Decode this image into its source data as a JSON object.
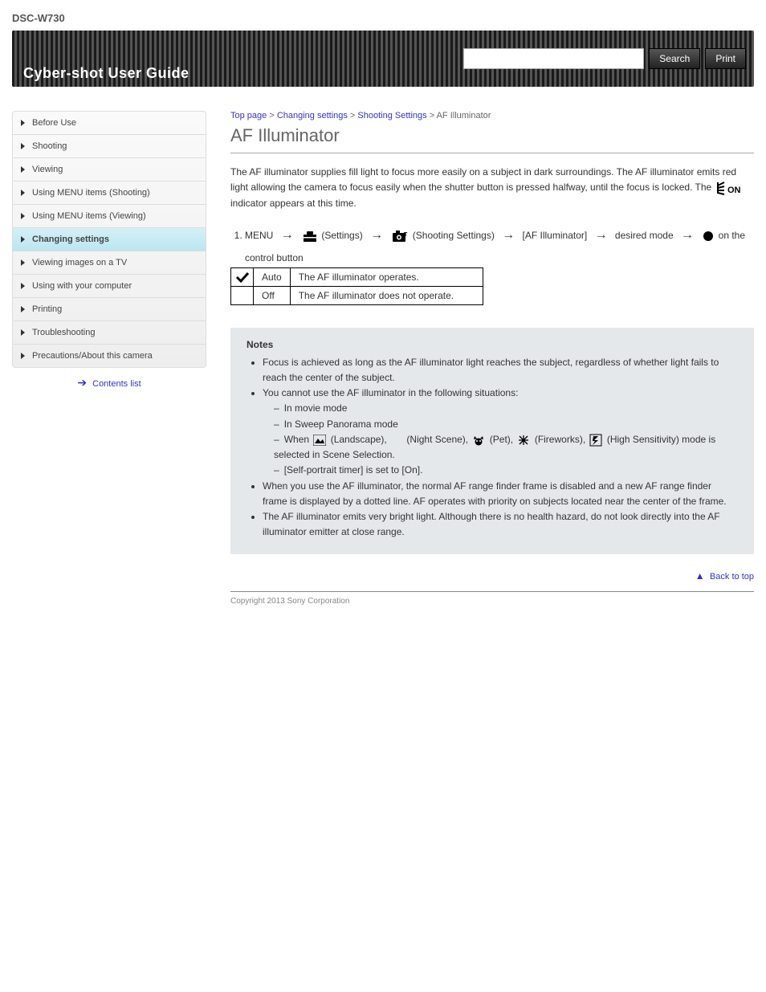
{
  "header": {
    "product": "DSC-W730",
    "title": "Cyber-shot User Guide",
    "search_placeholder": "",
    "search_btn": "Search",
    "print_btn": "Print"
  },
  "sidebar": {
    "items": [
      "Before Use",
      "Shooting",
      "Viewing",
      "Using MENU items (Shooting)",
      "Using MENU items (Viewing)",
      "Changing settings",
      "Viewing images on a TV",
      "Using with your computer",
      "Printing",
      "Troubleshooting",
      "Precautions/About this camera"
    ],
    "active_index": 5,
    "bottom_link": "Contents list"
  },
  "breadcrumb": {
    "top": "Top page",
    "cat": "Changing settings",
    "group": "Shooting Settings",
    "page": "AF Illuminator"
  },
  "article": {
    "title": "AF Illuminator",
    "intro_before": "The AF illuminator supplies fill light to focus more easily on a subject in dark surroundings.\nThe AF illuminator emits red light allowing the camera to focus easily when the shutter button is pressed halfway, until the focus is locked. The ",
    "intro_after": " indicator appears at this time.",
    "path": {
      "menu": "MENU",
      "settings": "(Settings)",
      "shooting_settings": "(Shooting Settings)",
      "item": "[AF Illuminator]",
      "mode": "desired mode",
      "confirm": "on the control button"
    },
    "options": [
      {
        "checked": true,
        "label": "Auto",
        "desc": "The AF illuminator operates."
      },
      {
        "checked": false,
        "label": "Off",
        "desc": "The AF illuminator does not operate."
      }
    ],
    "notes_title": "Notes",
    "notes": [
      {
        "text": "Focus is achieved as long as the AF illuminator light reaches the subject, regardless of whether light fails to reach the center of the subject."
      },
      {
        "text": "You cannot use the AF illuminator in the following situations:",
        "sub": [
          "In movie mode",
          "In Sweep Panorama mode",
          "SCENE_ICONS_LINE",
          "[Self-portrait timer] is set to [On]."
        ],
        "scene_text_before": "When ",
        "scene_text_middle": " mode is selected in Scene Selection.",
        "scene_modes": [
          "(Landscape)",
          "(Night Scene)",
          "(Pet)",
          "(Fireworks)",
          "(High Sensitivity)"
        ]
      },
      {
        "text": "When you use the AF illuminator, the normal AF range finder frame is disabled and a new AF range finder frame is displayed by a dotted line. AF operates with priority on subjects located near the center of the frame."
      },
      {
        "text": "The AF illuminator emits very bright light. Although there is no health hazard, do not look directly into the AF illuminator emitter at close range."
      }
    ]
  },
  "footer": {
    "back_to_top": "Back to top",
    "copyright": "Copyright 2013 Sony Corporation"
  }
}
